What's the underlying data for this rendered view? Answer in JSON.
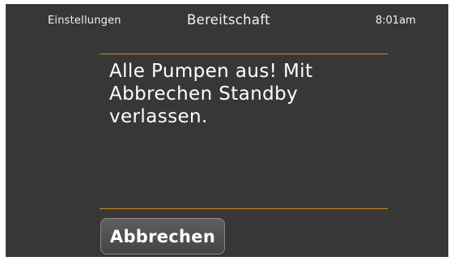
{
  "header": {
    "settings_label": "Einstellungen",
    "title": "Bereitschaft",
    "time": "8:01am"
  },
  "dialog": {
    "message": "Alle Pumpen aus! Mit Abbrechen Standby verlassen.",
    "cancel_label": "Abbrechen"
  },
  "colors": {
    "background": "#373737",
    "accent_rule": "#d48a2a",
    "text": "#ffffff"
  }
}
